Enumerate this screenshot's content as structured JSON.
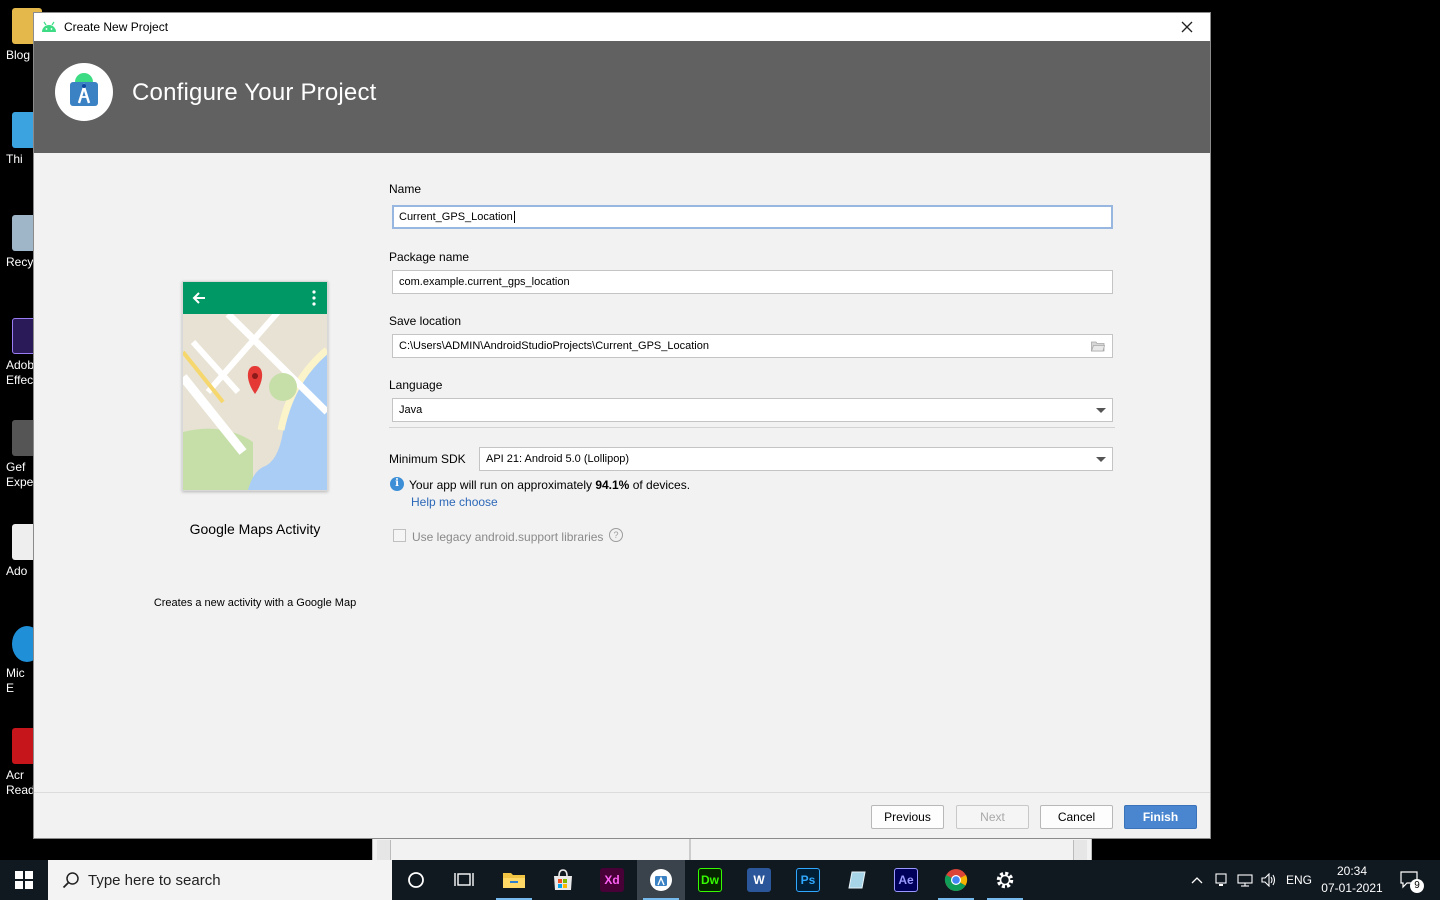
{
  "desktop": {
    "icons": [
      {
        "label": "Blog",
        "color": "#e5b84b"
      },
      {
        "label": "Thi",
        "color": "#3aa3e0"
      },
      {
        "label": "Recy",
        "color": "#9fb6c8"
      },
      {
        "label": "Adob\nEffec",
        "color": "#2b1a58"
      },
      {
        "label": "Gef\nExpe",
        "color": "#555555"
      },
      {
        "label": "Ado",
        "color": "#eeeeee"
      },
      {
        "label": "Mic\nE",
        "color": "#1f8fd8"
      },
      {
        "label": "Acr\nRead",
        "color": "#c6151b"
      }
    ]
  },
  "dialog": {
    "window_title": "Create New Project",
    "header_title": "Configure Your Project",
    "template": {
      "name": "Google Maps Activity",
      "description": "Creates a new activity with a Google Map"
    },
    "form": {
      "name_label": "Name",
      "name_value": "Current_GPS_Location",
      "package_label": "Package name",
      "package_value": "com.example.current_gps_location",
      "save_label": "Save location",
      "save_value": "C:\\Users\\ADMIN\\AndroidStudioProjects\\Current_GPS_Location",
      "language_label": "Language",
      "language_value": "Java",
      "min_sdk_label": "Minimum SDK",
      "min_sdk_value": "API 21: Android 5.0 (Lollipop)",
      "info_prefix": "Your app will run on approximately ",
      "info_percent": "94.1%",
      "info_suffix": " of devices.",
      "help_link": "Help me choose",
      "legacy_label": "Use legacy android.support libraries",
      "legacy_checked": false
    },
    "buttons": {
      "previous": "Previous",
      "next": "Next",
      "cancel": "Cancel",
      "finish": "Finish"
    }
  },
  "taskbar": {
    "search_placeholder": "Type here to search",
    "apps": [
      "cortana",
      "task-view",
      "file-explorer",
      "microsoft-store",
      "adobe-xd",
      "android-studio",
      "dreamweaver",
      "word",
      "photoshop",
      "notepad",
      "after-effects",
      "chrome",
      "settings"
    ],
    "xd_label": "Xd",
    "dw_label": "Dw",
    "ps_label": "Ps",
    "ae_label": "Ae",
    "word_label": "W",
    "language": "ENG",
    "time": "20:34",
    "date": "07-01-2021",
    "notification_count": "9"
  },
  "colors": {
    "header_bg": "#616161",
    "primary_button": "#4a86cf",
    "link": "#2c68b8",
    "map_toolbar": "#009966"
  }
}
